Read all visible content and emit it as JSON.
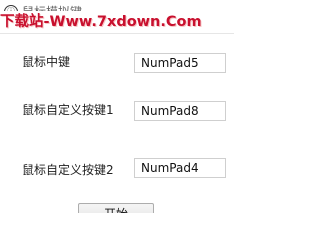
{
  "window": {
    "title": "鼠标模拟键"
  },
  "watermark": {
    "text": "下载站-Www.7xdown.Com"
  },
  "rows": [
    {
      "label": "鼠标中键",
      "value": "NumPad5"
    },
    {
      "label": "鼠标自定义按键1",
      "value": "NumPad8"
    },
    {
      "label": "鼠标自定义按键2",
      "value": "NumPad4"
    }
  ],
  "start_button": {
    "label": "开始"
  }
}
